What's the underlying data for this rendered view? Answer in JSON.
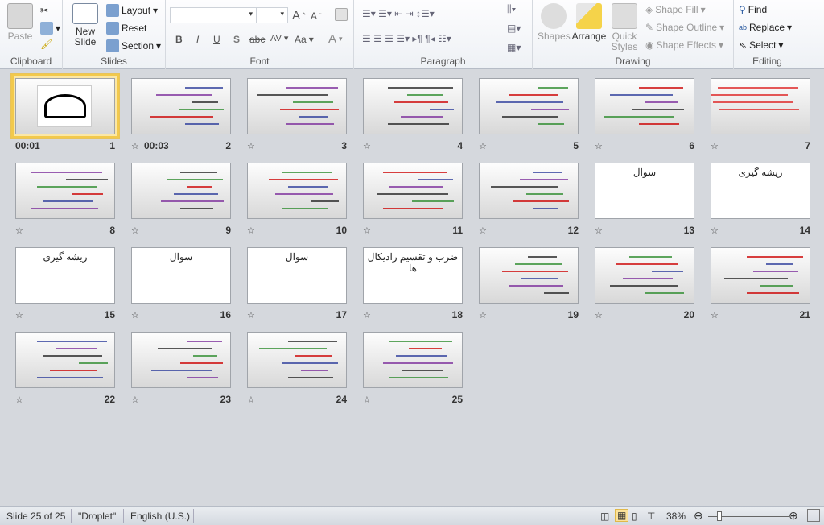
{
  "ribbon": {
    "clipboard": {
      "label": "Clipboard",
      "paste": "Paste"
    },
    "slides": {
      "label": "Slides",
      "new_slide": "New Slide",
      "layout": "Layout",
      "reset": "Reset",
      "section": "Section"
    },
    "font": {
      "label": "Font",
      "font_name": "",
      "font_size": "",
      "bold": "B",
      "italic": "I",
      "underline": "U",
      "shadow": "S",
      "strike": "abc",
      "spacing": "AV",
      "case": "Aa",
      "color": "A"
    },
    "paragraph": {
      "label": "Paragraph"
    },
    "drawing": {
      "label": "Drawing",
      "shapes": "Shapes",
      "arrange": "Arrange",
      "quick_styles": "Quick Styles",
      "shape_fill": "Shape Fill",
      "shape_outline": "Shape Outline",
      "shape_effects": "Shape Effects"
    },
    "editing": {
      "label": "Editing",
      "find": "Find",
      "replace": "Replace",
      "select": "Select"
    }
  },
  "slides": [
    {
      "n": "1",
      "time": "00:01",
      "selected": true,
      "title": "",
      "style": "calligraphy"
    },
    {
      "n": "2",
      "time": "00:03",
      "title": "",
      "style": "content"
    },
    {
      "n": "3",
      "title": "",
      "style": "content"
    },
    {
      "n": "4",
      "title": "",
      "style": "content"
    },
    {
      "n": "5",
      "title": "",
      "style": "content"
    },
    {
      "n": "6",
      "title": "",
      "style": "content"
    },
    {
      "n": "7",
      "title": "",
      "style": "redlines"
    },
    {
      "n": "8",
      "title": "",
      "style": "content"
    },
    {
      "n": "9",
      "title": "",
      "style": "content"
    },
    {
      "n": "10",
      "title": "",
      "style": "content"
    },
    {
      "n": "11",
      "title": "",
      "style": "content"
    },
    {
      "n": "12",
      "title": "",
      "style": "content"
    },
    {
      "n": "13",
      "title": "سوال",
      "style": "blank"
    },
    {
      "n": "14",
      "title": "ریشه گیری",
      "style": "blank"
    },
    {
      "n": "15",
      "title": "ریشه گیری",
      "style": "blank"
    },
    {
      "n": "16",
      "title": "سوال",
      "style": "blank"
    },
    {
      "n": "17",
      "title": "سوال",
      "style": "blank"
    },
    {
      "n": "18",
      "title": "ضرب و تقسیم رادیکال ها",
      "style": "blank"
    },
    {
      "n": "19",
      "title": "",
      "style": "content"
    },
    {
      "n": "20",
      "title": "",
      "style": "content"
    },
    {
      "n": "21",
      "title": "",
      "style": "content"
    },
    {
      "n": "22",
      "title": "",
      "style": "content"
    },
    {
      "n": "23",
      "title": "",
      "style": "content"
    },
    {
      "n": "24",
      "title": "",
      "style": "content"
    },
    {
      "n": "25",
      "title": "",
      "style": "content"
    }
  ],
  "status": {
    "slide": "Slide 25 of 25",
    "theme": "\"Droplet\"",
    "language": "English (U.S.)",
    "zoom": "38%"
  },
  "colors": {
    "selection": "#f2c94c",
    "ribbon_bg": "#f3f5f8",
    "sorter_bg": "#d5d8dd"
  }
}
